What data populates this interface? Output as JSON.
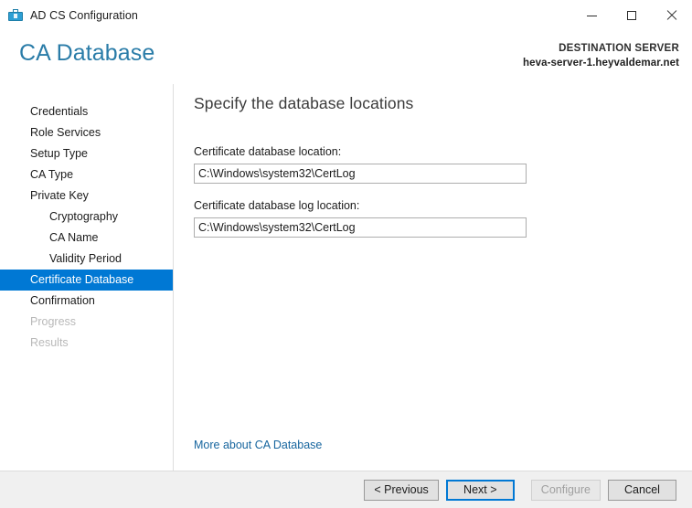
{
  "window": {
    "title": "AD CS Configuration",
    "icon": "ad-cs-toolbox-icon",
    "controls": {
      "minimize": "minimize-icon",
      "maximize": "maximize-icon",
      "close": "close-icon"
    }
  },
  "header": {
    "page_title": "CA Database",
    "destination_label": "DESTINATION SERVER",
    "destination_server": "heva-server-1.heyvaldemar.net"
  },
  "sidebar": {
    "items": [
      {
        "label": "Credentials",
        "state": "enabled",
        "level": 0
      },
      {
        "label": "Role Services",
        "state": "enabled",
        "level": 0
      },
      {
        "label": "Setup Type",
        "state": "enabled",
        "level": 0
      },
      {
        "label": "CA Type",
        "state": "enabled",
        "level": 0
      },
      {
        "label": "Private Key",
        "state": "enabled",
        "level": 0
      },
      {
        "label": "Cryptography",
        "state": "enabled",
        "level": 1
      },
      {
        "label": "CA Name",
        "state": "enabled",
        "level": 1
      },
      {
        "label": "Validity Period",
        "state": "enabled",
        "level": 1
      },
      {
        "label": "Certificate Database",
        "state": "active",
        "level": 0
      },
      {
        "label": "Confirmation",
        "state": "enabled",
        "level": 0
      },
      {
        "label": "Progress",
        "state": "disabled",
        "level": 0
      },
      {
        "label": "Results",
        "state": "disabled",
        "level": 0
      }
    ]
  },
  "main": {
    "heading": "Specify the database locations",
    "fields": [
      {
        "label": "Certificate database location:",
        "value": "C:\\Windows\\system32\\CertLog",
        "placeholder": ""
      },
      {
        "label": "Certificate database log location:",
        "value": "C:\\Windows\\system32\\CertLog",
        "placeholder": ""
      }
    ],
    "more_link": "More about CA Database"
  },
  "footer": {
    "buttons": [
      {
        "label": "< Previous",
        "state": "enabled"
      },
      {
        "label": "Next >",
        "state": "default"
      },
      {
        "label": "Configure",
        "state": "disabled"
      },
      {
        "label": "Cancel",
        "state": "enabled"
      }
    ]
  },
  "colors": {
    "accent_blue": "#0078d4",
    "title_teal": "#2a7ca8",
    "link_blue": "#16659e",
    "footer_bg": "#f0f0f0",
    "disabled_text": "#b9b9b9"
  }
}
